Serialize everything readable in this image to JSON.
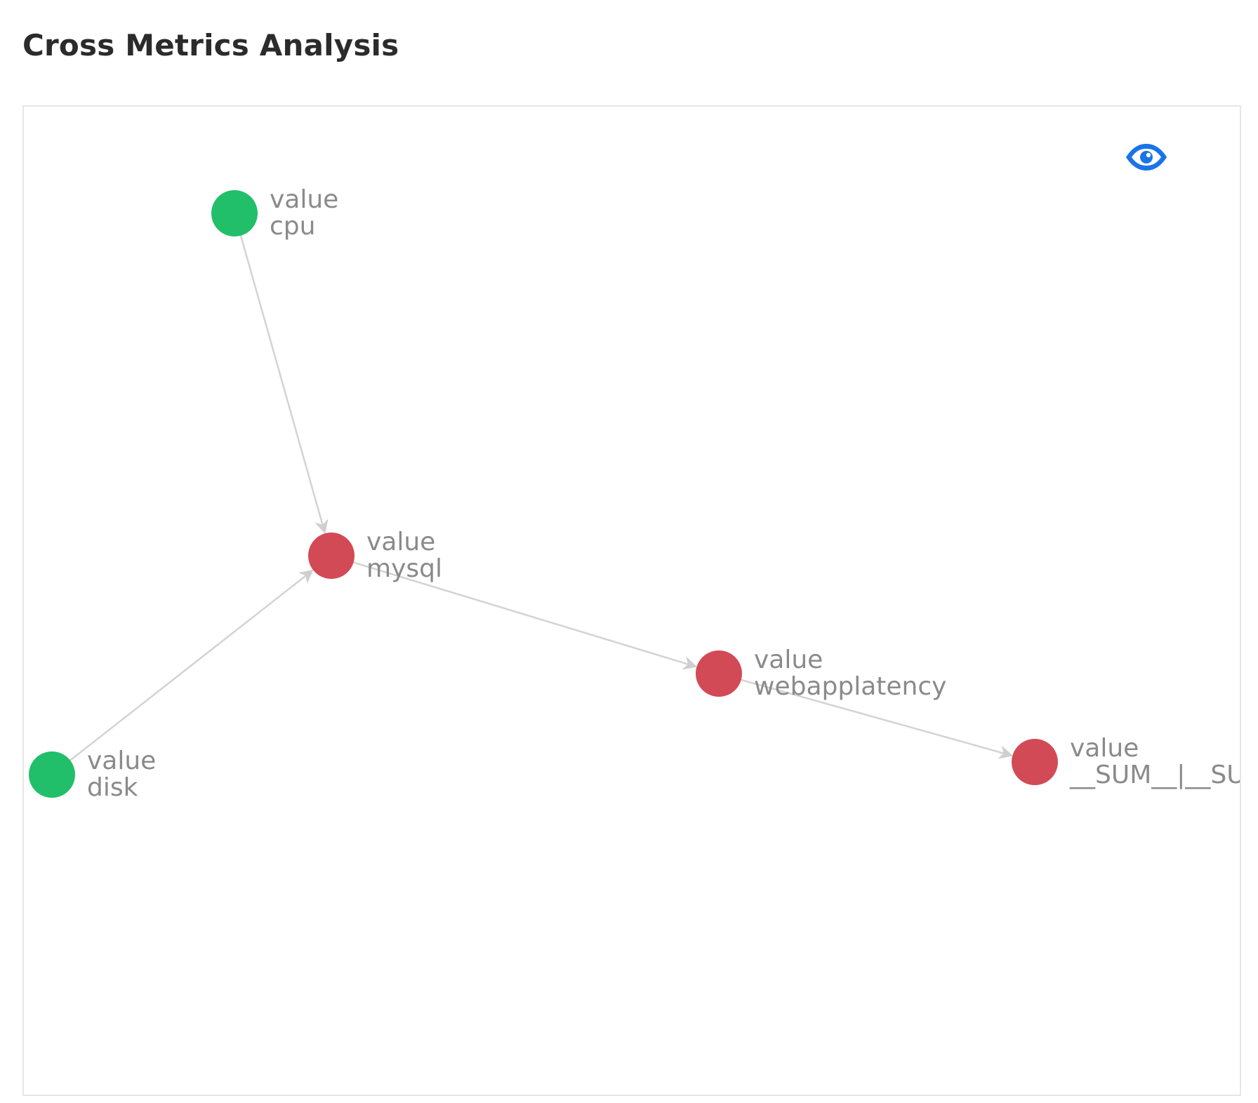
{
  "page": {
    "title": "Cross Metrics Analysis"
  },
  "toolbar": {
    "toggle_icon": "eye-icon",
    "icon_color": "#1a73e8"
  },
  "graph": {
    "colors": {
      "root": "#21bf69",
      "affected": "#d24a56",
      "edge": "#d3d3d3",
      "label": "#8a8a8a"
    },
    "nodes": [
      {
        "id": "cpu",
        "line1": "value",
        "line2": "cpu",
        "status": "root"
      },
      {
        "id": "mysql",
        "line1": "value",
        "line2": "mysql",
        "status": "affected"
      },
      {
        "id": "disk",
        "line1": "value",
        "line2": "disk",
        "status": "root"
      },
      {
        "id": "webapplatency",
        "line1": "value",
        "line2": "webapplatency",
        "status": "affected"
      },
      {
        "id": "sum",
        "line1": "value",
        "line2": "__SUM__|__SU",
        "status": "affected"
      }
    ],
    "edges": [
      {
        "from": "cpu",
        "to": "mysql"
      },
      {
        "from": "disk",
        "to": "mysql"
      },
      {
        "from": "mysql",
        "to": "webapplatency"
      },
      {
        "from": "webapplatency",
        "to": "sum"
      }
    ]
  }
}
